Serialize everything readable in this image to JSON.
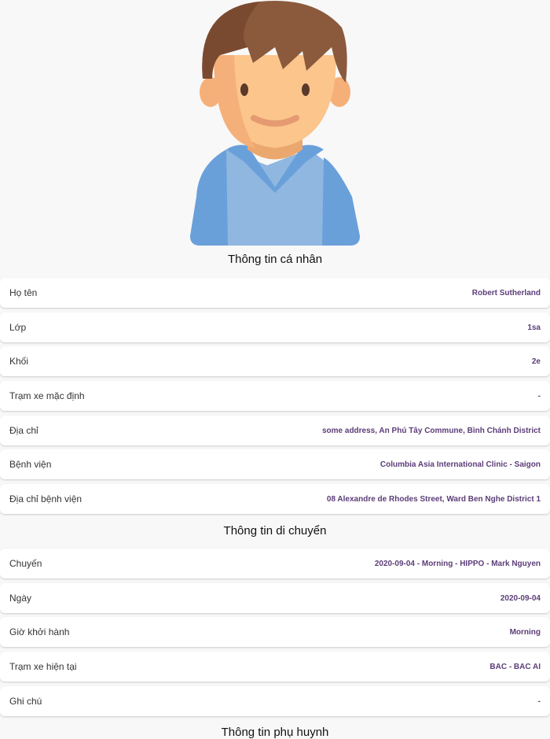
{
  "sections": {
    "personal_title": "Thông tin cá nhân",
    "transport_title": "Thông tin di chuyển",
    "parent_title": "Thông tin phụ huynh"
  },
  "personal": [
    {
      "label": "Họ tên",
      "value": "Robert Sutherland"
    },
    {
      "label": "Lớp",
      "value": "1sa"
    },
    {
      "label": "Khối",
      "value": "2e"
    },
    {
      "label": "Trạm xe mặc định",
      "value": "-"
    },
    {
      "label": "Địa chỉ",
      "value": "some address, An Phú Tây Commune, Bình Chánh District"
    },
    {
      "label": "Bệnh viện",
      "value": "Columbia Asia International Clinic - Saigon"
    },
    {
      "label": "Địa chỉ bệnh viện",
      "value": "08 Alexandre de Rhodes Street, Ward Ben Nghe District 1"
    }
  ],
  "transport": [
    {
      "label": "Chuyến",
      "value": "2020-09-04 - Morning - HIPPO - Mark Nguyen"
    },
    {
      "label": "Ngày",
      "value": "2020-09-04"
    },
    {
      "label": "Giờ khởi hành",
      "value": "Morning"
    },
    {
      "label": "Trạm xe hiện tại",
      "value": "BAC - BAC AI"
    },
    {
      "label": "Ghi chú",
      "value": "-"
    }
  ],
  "colors": {
    "value_text": "#5c3d78",
    "background": "#f8f8f9"
  }
}
